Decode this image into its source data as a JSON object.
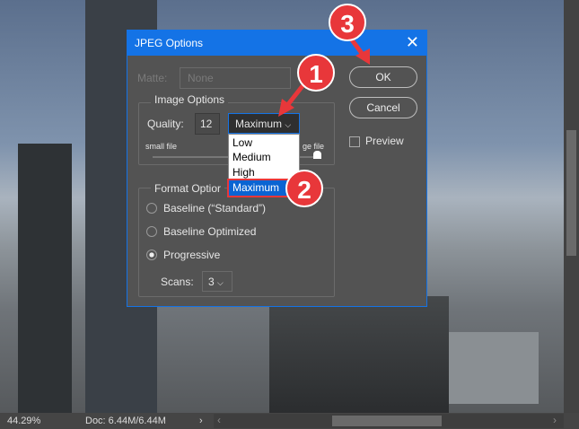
{
  "dialog": {
    "title": "JPEG Options",
    "matte_label": "Matte:",
    "matte_value": "None",
    "image_options": "Image Options",
    "quality_label": "Quality:",
    "quality_value": "12",
    "quality_preset": "Maximum",
    "small_file": "small file",
    "large_file": "ge file",
    "dropdown_options": [
      "Low",
      "Medium",
      "High",
      "Maximum"
    ],
    "format_options": "Format Optior",
    "baseline": "Baseline (“Standard”)",
    "baseline_opt": "Baseline Optimized",
    "progressive": "Progressive",
    "scans_label": "Scans:",
    "scans_value": "3",
    "ok": "OK",
    "cancel": "Cancel",
    "preview": "Preview"
  },
  "annotations": [
    "1",
    "2",
    "3"
  ],
  "status": {
    "zoom": "44.29%",
    "doc": "Doc: 6.44M/6.44M"
  }
}
